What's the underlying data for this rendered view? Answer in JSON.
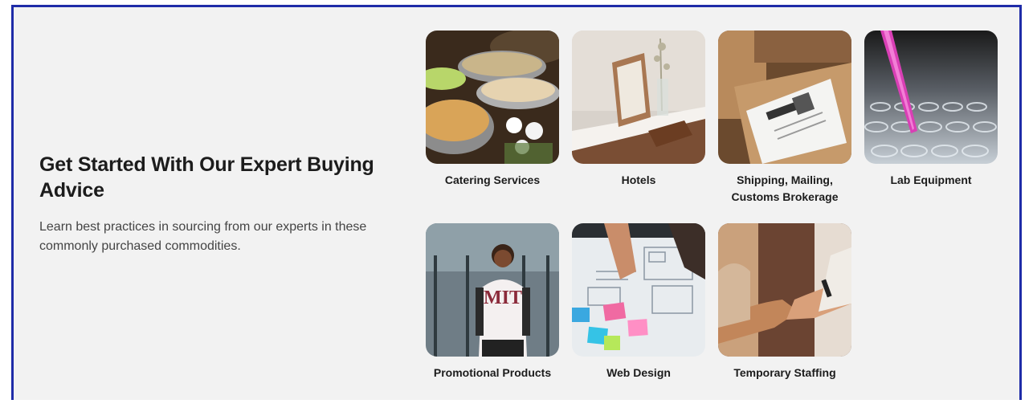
{
  "intro": {
    "heading": "Get Started With Our Expert Buying Advice",
    "description": "Learn best practices in sourcing from our experts in these commonly purchased commodities."
  },
  "categories": [
    {
      "label": "Catering Services"
    },
    {
      "label": "Hotels"
    },
    {
      "label": "Shipping, Mailing, Customs Brokerage"
    },
    {
      "label": "Lab Equipment"
    },
    {
      "label": "Promotional Products"
    },
    {
      "label": "Web Design"
    },
    {
      "label": "Temporary Staffing"
    }
  ],
  "colors": {
    "frame_border": "#1f2ca8",
    "panel_background": "#f2f2f2",
    "text": "#1c1c1c"
  }
}
